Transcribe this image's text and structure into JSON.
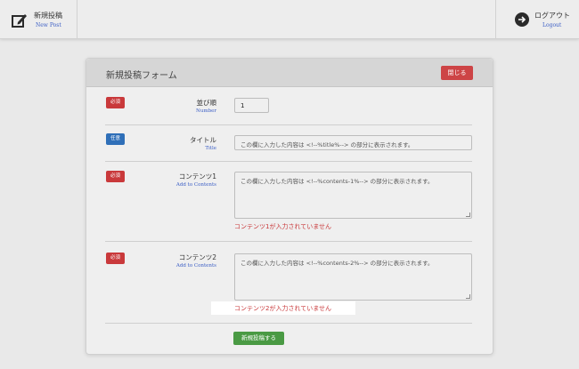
{
  "header": {
    "new_post": {
      "label": "新規投稿",
      "sub": "New Post",
      "icon": "edit-icon"
    },
    "logout": {
      "label": "ログアウト",
      "sub": "Logout",
      "icon": "arrow-right-circle-icon"
    }
  },
  "form": {
    "title": "新規投稿フォーム",
    "close_label": "閉じる",
    "fields": {
      "order": {
        "badge": "必須",
        "label": "並び順",
        "sub": "Number",
        "value": "1"
      },
      "title": {
        "badge": "任意",
        "label": "タイトル",
        "sub": "Title",
        "placeholder": "この欄に入力した内容は <!--%title%--> の部分に表示されます。"
      },
      "content1": {
        "badge": "必須",
        "label": "コンテンツ1",
        "sub": "Add to Contents",
        "placeholder": "この欄に入力した内容は <!--%contents-1%--> の部分に表示されます。",
        "error": "コンテンツ1が入力されていません"
      },
      "content2": {
        "badge": "必須",
        "label": "コンテンツ2",
        "sub": "Add to Contents",
        "placeholder": "この欄に入力した内容は <!--%contents-2%--> の部分に表示されます。",
        "error": "コンテンツ2が入力されていません"
      }
    },
    "submit_label": "新規投稿する"
  },
  "colors": {
    "required": "#c9393b",
    "optional": "#2f6fb8",
    "submit": "#4a9a44",
    "close": "#cd4446",
    "sub_link": "#3b5ec5"
  }
}
